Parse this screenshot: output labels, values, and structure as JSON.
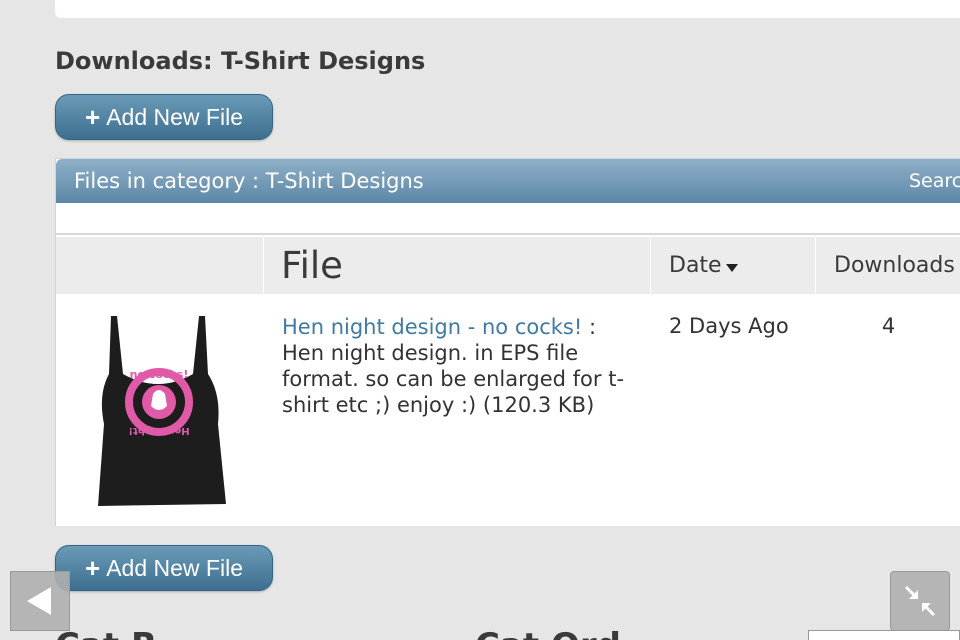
{
  "page": {
    "heading": "Downloads: T-Shirt Designs"
  },
  "buttons": {
    "add_top_label": "Add New File",
    "add_bottom_label": "Add New File",
    "plus_glyph": "+"
  },
  "panel": {
    "title": "Files in category : T-Shirt Designs",
    "search_label": "Searc"
  },
  "table": {
    "columns": {
      "file": "File",
      "date": "Date",
      "downloads": "Downloads"
    },
    "sort_indicator": "date-desc",
    "rows": [
      {
        "thumbnail_icon": "tank-top-thumbnail",
        "thumbnail_text_top": "no cocks!",
        "thumbnail_text_bottom": "Hen Night!",
        "title": "Hen night design - no cocks!",
        "separator": " :",
        "description": "Hen night design. in EPS file format. so can be enlarged for t-shirt etc ;) enjoy :) (120.3 KB)",
        "date": "2 Days Ago",
        "downloads": "4"
      }
    ]
  },
  "footer": {
    "heading_left": "Cat R",
    "heading_right": "Cat Ord"
  },
  "nav": {
    "back_icon": "left-arrow-icon",
    "collapse_icon": "collapse-arrows-icon"
  },
  "colors": {
    "accent": "#3f7aa3",
    "header_blue": "#5c87a6",
    "thumbnail_pink": "#e05aa8"
  }
}
